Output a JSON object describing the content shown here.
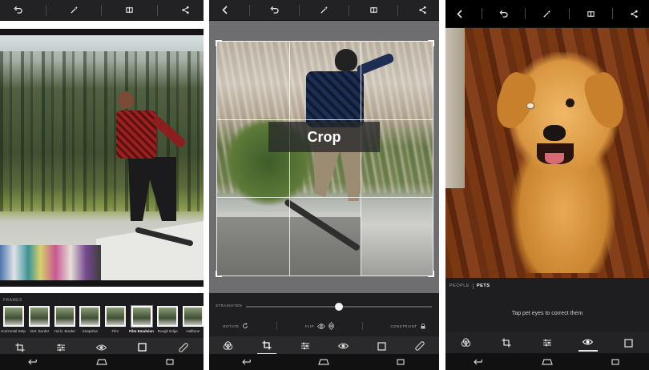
{
  "phone1": {
    "tabs_label": "FRAMES",
    "thumbnails": [
      {
        "label": "Horizontal Strip"
      },
      {
        "label": "Vert. Border"
      },
      {
        "label": "Horiz. Border"
      },
      {
        "label": "Snapshot"
      },
      {
        "label": "Film"
      },
      {
        "label": "Film Emulsion"
      },
      {
        "label": "Rough Edge"
      },
      {
        "label": "Halftone"
      }
    ],
    "selected_thumbnail": "Film Emulsion"
  },
  "phone2": {
    "crop_overlay_text": "Crop",
    "straighten_label": "STRAIGHTEN",
    "straighten_value": 0.5,
    "rotate_label": "ROTATE",
    "flip_label": "FLIP",
    "constraint_label": "CONSTRAINT"
  },
  "phone3": {
    "tab_people": "PEOPLE",
    "tab_pets": "PETS",
    "hint_text": "Tap pet eyes to correct them"
  },
  "icons": {
    "top": [
      "back-icon",
      "undo-icon",
      "magic-wand-icon",
      "compare-icon",
      "share-icon"
    ],
    "bottom_nav": [
      "nav-back-icon",
      "nav-home-icon",
      "nav-recents-icon"
    ]
  },
  "colors": {
    "phone_bg": "#1d1d1f",
    "toolbar_bg": "#2a2a2c",
    "text_light": "#cfcfcf"
  }
}
